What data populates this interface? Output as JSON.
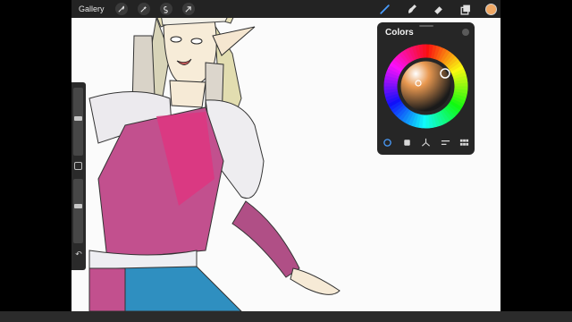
{
  "toolbar": {
    "gallery_label": "Gallery",
    "left_icons": [
      "wrench-icon",
      "magic-wand-icon",
      "selection-icon",
      "transform-arrow-icon"
    ],
    "right_tools": [
      "brush-icon",
      "smudge-icon",
      "eraser-icon",
      "layers-icon"
    ],
    "current_color": "#f0a864",
    "active_tool_color": "#4a9eff"
  },
  "colors_panel": {
    "title": "Colors",
    "selected_color": "#f0a864",
    "tabs": [
      "disc-tab-icon",
      "classic-tab-icon",
      "harmony-tab-icon",
      "value-tab-icon",
      "palettes-tab-icon"
    ],
    "active_tab": "disc-tab-icon"
  },
  "sidebar": {
    "brush_size_level": 0.55,
    "opacity_level": 0.58
  }
}
